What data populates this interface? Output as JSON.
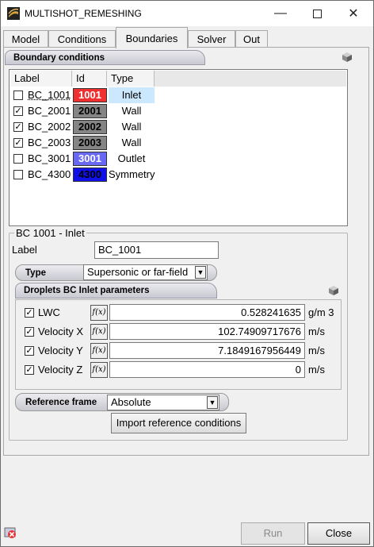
{
  "window": {
    "title": "MULTISHOT_REMESHING"
  },
  "tabs": [
    "Model",
    "Conditions",
    "Boundaries",
    "Solver",
    "Out"
  ],
  "active_tab": "Boundaries",
  "bc_section": {
    "title": "Boundary conditions"
  },
  "table": {
    "headers": [
      "Label",
      "Id",
      "Type"
    ],
    "rows": [
      {
        "label": "BC_1001",
        "id": "1001",
        "type": "Inlet",
        "checked": false,
        "color": "#f03030",
        "id_text_color": "#ffffff",
        "selected": true
      },
      {
        "label": "BC_2001",
        "id": "2001",
        "type": "Wall",
        "checked": true,
        "color": "#858585",
        "id_text_color": "#000000",
        "selected": false
      },
      {
        "label": "BC_2002",
        "id": "2002",
        "type": "Wall",
        "checked": true,
        "color": "#858585",
        "id_text_color": "#000000",
        "selected": false
      },
      {
        "label": "BC_2003",
        "id": "2003",
        "type": "Wall",
        "checked": true,
        "color": "#858585",
        "id_text_color": "#000000",
        "selected": false
      },
      {
        "label": "BC_3001",
        "id": "3001",
        "type": "Outlet",
        "checked": false,
        "color": "#6868f2",
        "id_text_color": "#ffffff",
        "selected": false
      },
      {
        "label": "BC_4300",
        "id": "4300",
        "type": "Symmetry",
        "checked": false,
        "color": "#1010e8",
        "id_text_color": "#000000",
        "selected": false
      }
    ]
  },
  "detail": {
    "group_title": "BC 1001 - Inlet",
    "label_caption": "Label",
    "label_value": "BC_1001",
    "type_caption": "Type",
    "type_value": "Supersonic or far-field",
    "droplets_title": "Droplets BC Inlet parameters",
    "params": [
      {
        "name": "LWC",
        "checked": true,
        "fx": "f(x)",
        "value": "0.528241635",
        "unit": "g/m 3"
      },
      {
        "name": "Velocity X",
        "checked": true,
        "fx": "f(x)",
        "value": "102.74909717676",
        "unit": "m/s"
      },
      {
        "name": "Velocity Y",
        "checked": true,
        "fx": "f(x)",
        "value": "7.1849167956449",
        "unit": "m/s"
      },
      {
        "name": "Velocity Z",
        "checked": true,
        "fx": "f(x)",
        "value": "0",
        "unit": "m/s"
      }
    ],
    "ref_frame_caption": "Reference frame",
    "ref_frame_value": "Absolute",
    "import_button": "Import reference conditions"
  },
  "footer": {
    "run_label": "Run",
    "close_label": "Close"
  }
}
